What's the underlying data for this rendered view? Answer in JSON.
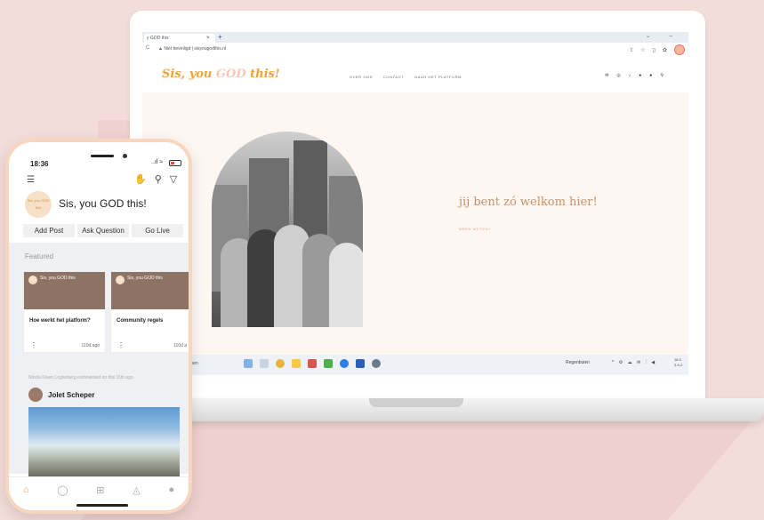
{
  "browser": {
    "tab_title": "y GOD this",
    "tab_close": "×",
    "new_tab": "+",
    "window_controls": "⌄ –",
    "reload": "C",
    "address": "▲  Niet beveiligd  |  sisyougodthis.nl",
    "icons": [
      "share-icon",
      "star-icon",
      "sidepanel-icon",
      "extensions-icon",
      "profile-avatar"
    ]
  },
  "site": {
    "logo_part1": "Sis, you ",
    "logo_god": "GOD",
    "logo_part2": " this!",
    "nav": [
      "OVER ONS",
      "CONTACT",
      "NAAR HET PLATFORM"
    ],
    "social_icons": [
      "mail-icon",
      "instagram-icon",
      "tiktok-icon",
      "pinterest-icon",
      "facebook-icon",
      "search-icon"
    ],
    "hero_title": "jij bent zó welkom hier!",
    "hero_more": "MEER WETEN?"
  },
  "taskbar": {
    "search_label": "eken",
    "weather": "Regenbuien",
    "tray": "^ ⚙ ☁ ✉ ⫶ ◀",
    "clock_time": "18:3",
    "clock_date": "3-9-2"
  },
  "phone": {
    "time": "18:36",
    "signal": "..ıl ≈",
    "group_logo": "Sis, you GOD this",
    "group_name": "Sis, you GOD this!",
    "tabs": [
      "Add Post",
      "Ask Question",
      "Go Live"
    ],
    "featured_label": "Featured",
    "cards": [
      {
        "img_title": "Sis, you GOD this",
        "name": "Hoe werkt het platform?",
        "age": "110d ago"
      },
      {
        "img_title": "Sis, you GOD this",
        "name": "Community regels",
        "age": "110d a"
      }
    ],
    "commented": "Nicola Kloen Logterberg commented on this 11th ago",
    "user_name": "Jolet Scheper",
    "nav_icons": [
      "home-icon",
      "chat-icon",
      "add-icon",
      "bell-icon",
      "profile-icon"
    ]
  },
  "colors": {
    "background": "#f3dcd9",
    "logo_orange": "#f0a23c",
    "hero_text": "#c6926a",
    "phone_frame": "#f7d6c0"
  }
}
